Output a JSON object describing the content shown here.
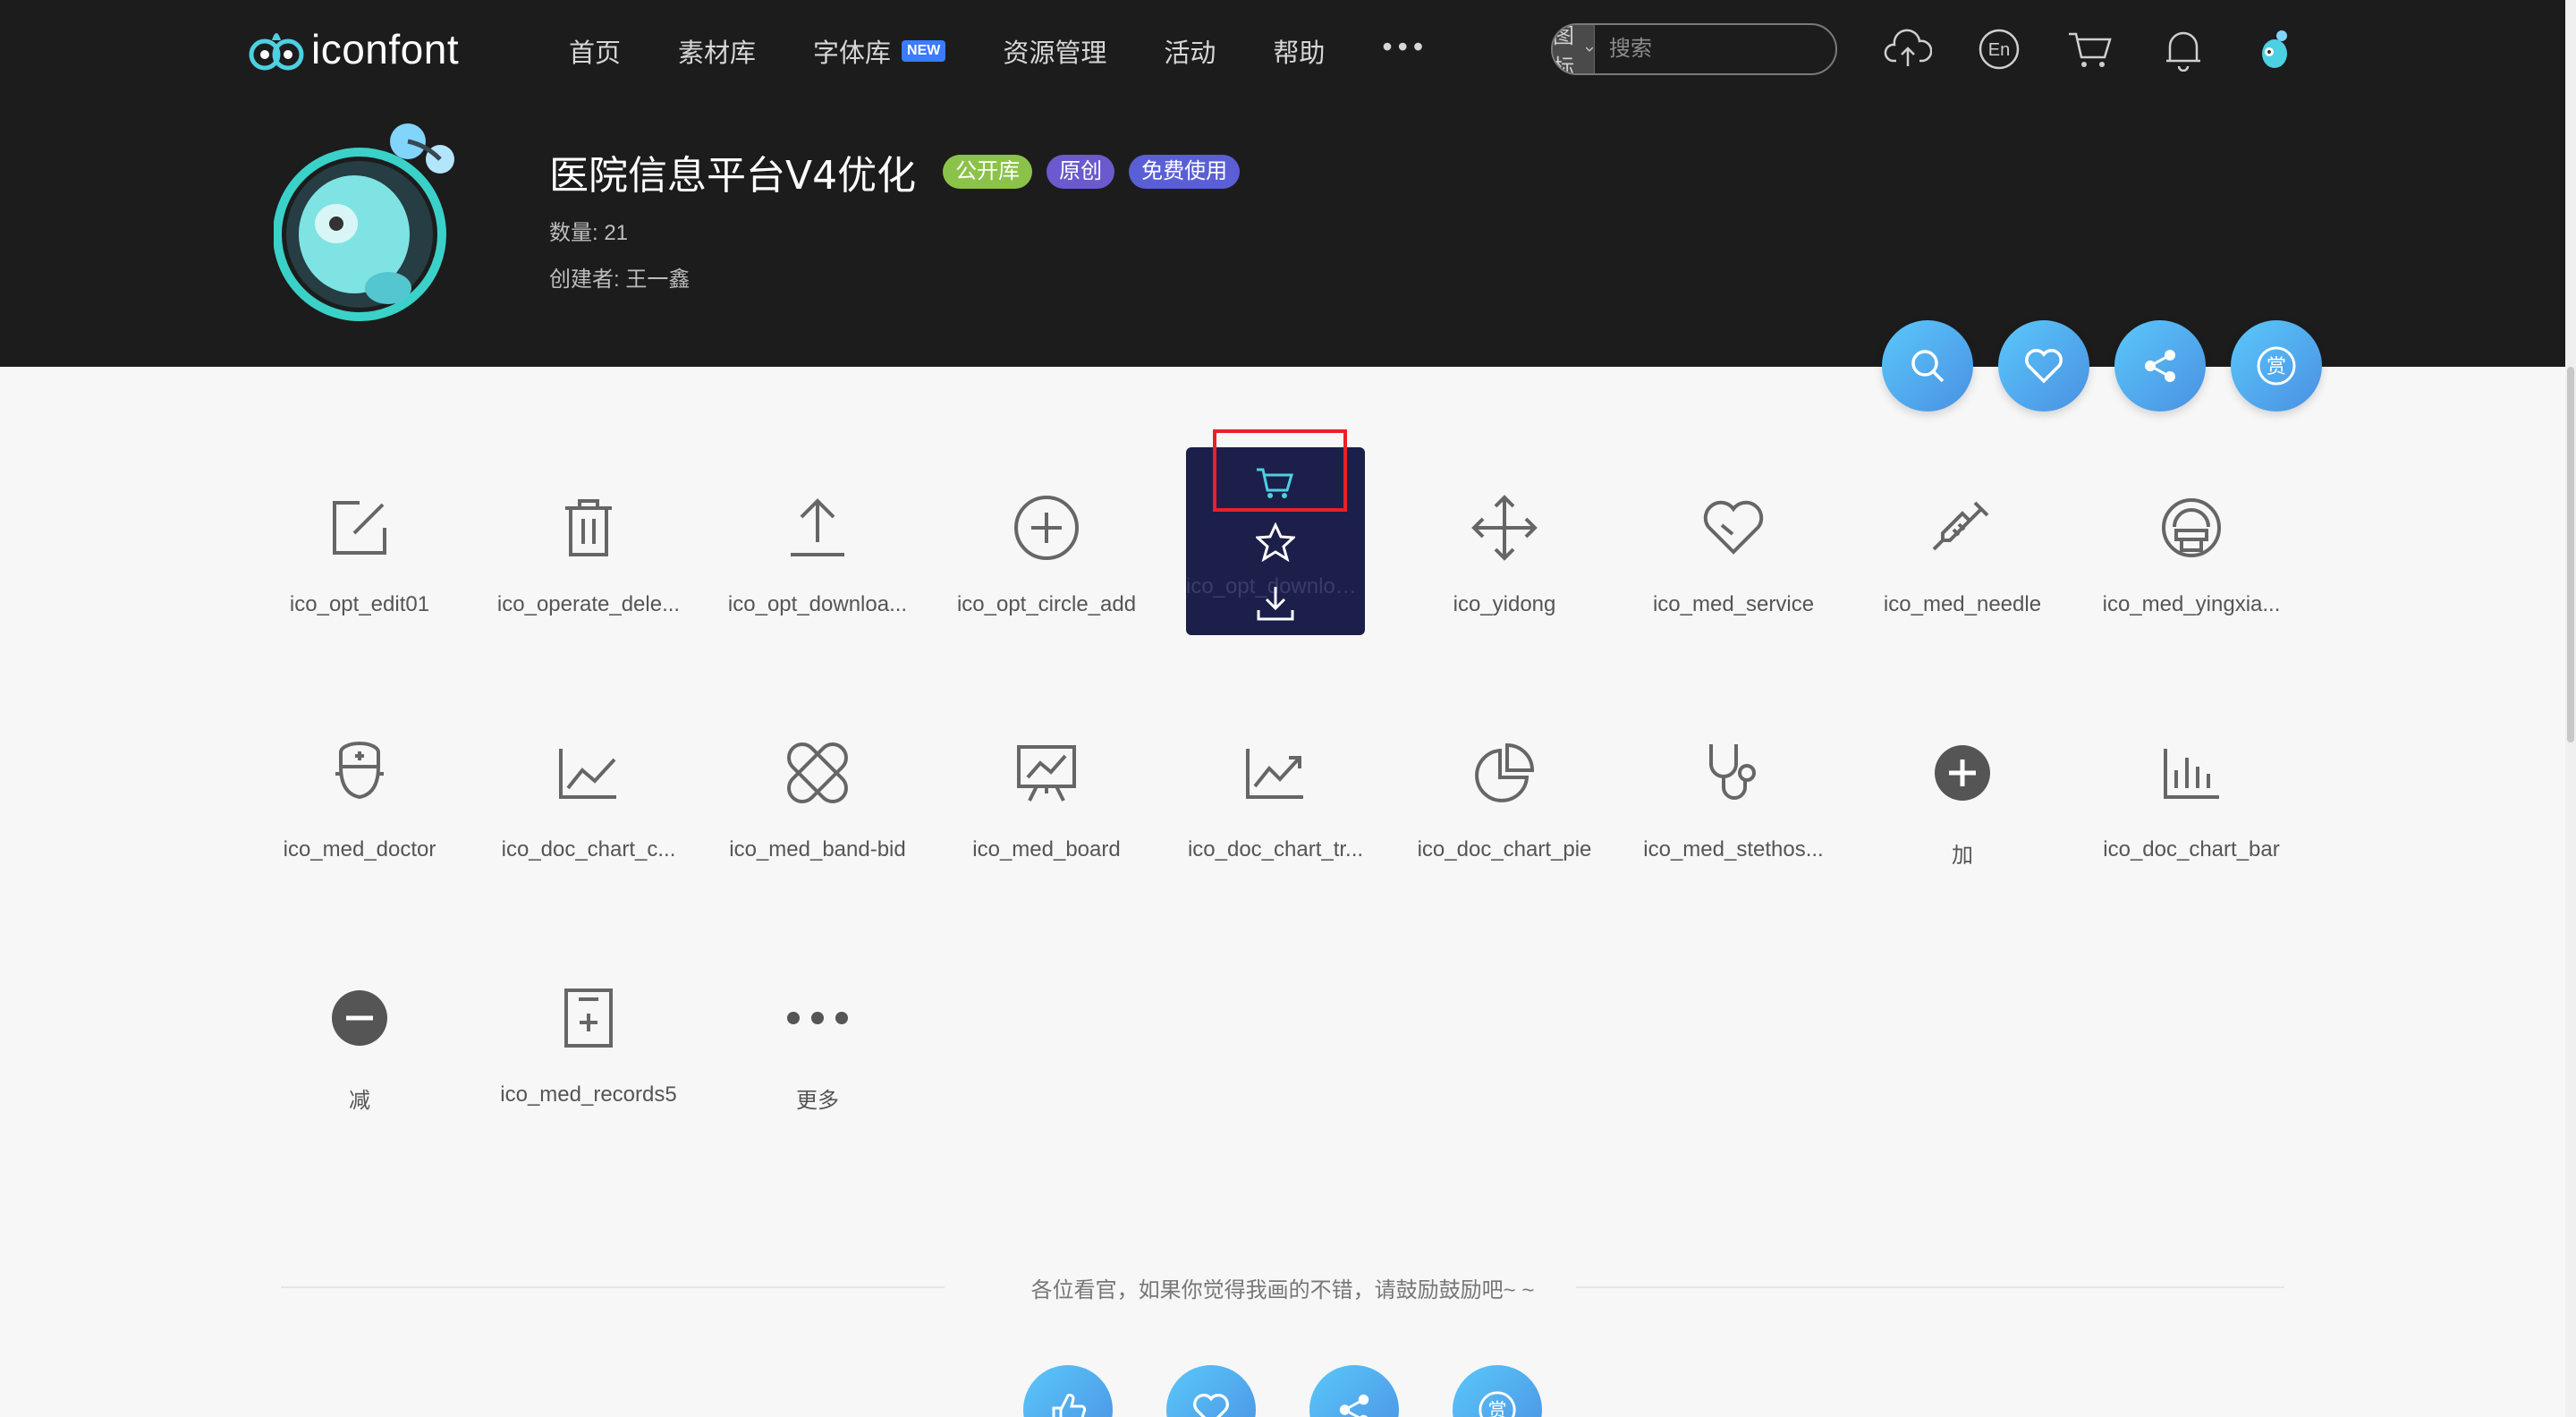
{
  "header": {
    "logo_text": "iconfont",
    "nav": [
      {
        "label": "首页",
        "badge": ""
      },
      {
        "label": "素材库",
        "badge": ""
      },
      {
        "label": "字体库",
        "badge": "NEW"
      },
      {
        "label": "资源管理",
        "badge": ""
      },
      {
        "label": "活动",
        "badge": ""
      },
      {
        "label": "帮助",
        "badge": ""
      }
    ],
    "search": {
      "type_label": "图标",
      "placeholder": "搜索"
    },
    "icons": [
      "upload-icon",
      "language-en-icon",
      "cart-icon",
      "bell-icon",
      "avatar"
    ]
  },
  "project": {
    "title": "医院信息平台V4优化",
    "tags": [
      "公开库",
      "原创",
      "免费使用"
    ],
    "count_label": "数量: 21",
    "creator_label": "创建者: 王一鑫"
  },
  "action_buttons": [
    "search-icon",
    "heart-icon",
    "share-icon",
    "reward-icon"
  ],
  "reward_glyph": "赏",
  "icon_list": [
    {
      "name": "ico_opt_edit01",
      "icon": "edit-icon"
    },
    {
      "name": "ico_operate_dele...",
      "icon": "trash-icon"
    },
    {
      "name": "ico_opt_downloa...",
      "icon": "upload-arrow-icon"
    },
    {
      "name": "ico_opt_circle_add",
      "icon": "circle-plus-icon"
    },
    {
      "name": "ico_opt_downloa...",
      "icon": "download-icon",
      "hovered": true
    },
    {
      "name": "ico_yidong",
      "icon": "move-icon"
    },
    {
      "name": "ico_med_service",
      "icon": "heart-outline-icon"
    },
    {
      "name": "ico_med_needle",
      "icon": "syringe-icon"
    },
    {
      "name": "ico_med_yingxia...",
      "icon": "scanner-icon"
    },
    {
      "name": "ico_med_doctor",
      "icon": "doctor-icon"
    },
    {
      "name": "ico_doc_chart_c...",
      "icon": "line-chart-icon"
    },
    {
      "name": "ico_med_band-bid",
      "icon": "bandage-icon"
    },
    {
      "name": "ico_med_board",
      "icon": "board-icon"
    },
    {
      "name": "ico_doc_chart_tr...",
      "icon": "trend-chart-icon"
    },
    {
      "name": "ico_doc_chart_pie",
      "icon": "pie-chart-icon"
    },
    {
      "name": "ico_med_stethos...",
      "icon": "stethoscope-icon"
    },
    {
      "name": "加",
      "icon": "plus-filled-icon"
    },
    {
      "name": "ico_doc_chart_bar",
      "icon": "bar-chart-icon"
    },
    {
      "name": "减",
      "icon": "minus-filled-icon"
    },
    {
      "name": "ico_med_records5",
      "icon": "records-icon"
    },
    {
      "name": "更多",
      "icon": "more-dots-icon"
    }
  ],
  "hover_card": {
    "actions": [
      "cart-icon",
      "star-icon",
      "download-icon"
    ]
  },
  "footer": {
    "text": "各位看官，如果你觉得我画的不错，请鼓励鼓励吧~ ~",
    "buttons": [
      "like-icon",
      "heart-icon",
      "share-icon",
      "reward-icon"
    ]
  },
  "colors": {
    "accent": "#4a90e2",
    "header_bg": "#1c1c1c",
    "hover_card_bg": "#1c1f4a",
    "highlight": "#e8202a",
    "icon_stroke": "#666666"
  }
}
